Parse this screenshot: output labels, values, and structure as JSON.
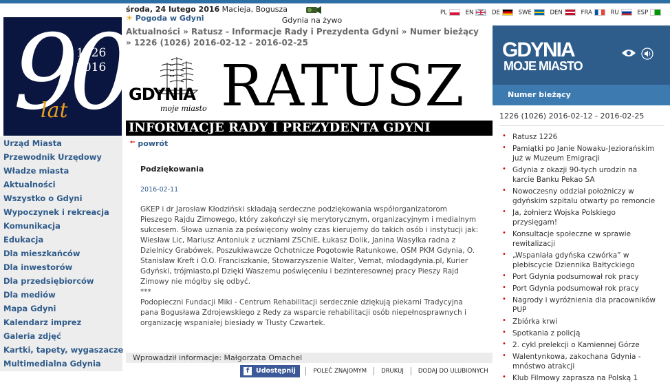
{
  "header": {
    "date": "środa, 24 lutego 2016",
    "names": "Macieja, Bogusza",
    "weather": "Pogoda w Gdyni",
    "live": "Gdynia na żywo",
    "languages": [
      {
        "code": "PL",
        "flag": "pl-flag"
      },
      {
        "code": "EN",
        "flag": "uk-flag"
      },
      {
        "code": "DE",
        "flag": "de-flag"
      },
      {
        "code": "SWE",
        "flag": "se-flag"
      },
      {
        "code": "DEN",
        "flag": "dk-flag"
      },
      {
        "code": "FRA",
        "flag": "fr-flag"
      },
      {
        "code": "RU",
        "flag": "ru-flag"
      },
      {
        "code": "ESP",
        "flag": "eo-flag"
      }
    ]
  },
  "logo": {
    "number": "90",
    "years": [
      "1926",
      "2016"
    ],
    "lat": "lat"
  },
  "nav": [
    "Urząd Miasta",
    "Przewodnik Urzędowy",
    "Władze miasta",
    "Aktualności",
    "Wszystko o Gdyni",
    "Wypoczynek i rekreacja",
    "Komunikacja",
    "Edukacja",
    "Dla mieszkańców",
    "Dla inwestorów",
    "Dla przedsiębiorców",
    "Dla mediów",
    "Mapa Gdyni",
    "Kalendarz imprez",
    "Galeria zdjęć",
    "Kartki, tapety, wygaszacze",
    "Multimedialna Gdynia"
  ],
  "breadcrumb": "Aktualności » Ratusz - Informacje Rady i Prezydenta Gdyni » Numer bieżący » 1226 (1026) 2016-02-12 - 2016-02-25",
  "banner": {
    "gdynia": "GDYNIA",
    "moje": "moje miasto",
    "ratusz": "RATUSZ",
    "strip": "INFORMACJE RADY I PREZYDENTA GDYNI"
  },
  "back": "powrót",
  "article": {
    "title": "Podziękowania",
    "date": "2016-02-11",
    "p1": "GKEP i dr Jarosław Kłodziński składają serdeczne podziękowania współorganizatorom Pieszego Rajdu Zimowego, który zakończył się merytorycznym, organizacyjnym i medialnym sukcesem. Słowa uznania za poświęcony wolny czas kierujemy do takich osób i instytucji jak: Wiesław Lic, Mariusz Antoniuk z uczniami ZSChiE, Łukasz Dolik, Janina Wasylka radna z Dzielnicy Grabówek, Poszukiwawcze Ochotnicze Pogotowie Ratunkowe, OSM PKM Gdynia, O. Stanisław Kreft i O.O. Franciszkanie, Stowarzyszenie Walter, Vemat, mlodagdynia.pl, Kurier Gdyński, trójmiasto.pl Dzięki Waszemu poświęceniu i bezinteresownej pracy Pieszy Rajd Zimowy nie mógłby się odbyć.",
    "sep": "***",
    "p2": "Podopieczni Fundacji Miki - Centrum Rehabilitacji serdecznie dziękują piekarni Tradycyjna pana Bogusława Zdrojewskiego z Redy za wsparcie rehabilitacji osób niepełnosprawnych i organizację wspaniałej biesiady w Tłusty Czwartek."
  },
  "footer": {
    "info": "Wprowadził informacje: Małgorzata Omachel",
    "share": "Udostępnij",
    "actions": [
      "POLEĆ ZNAJOMYM",
      "DRUKUJ",
      "DODAJ DO ULUBIONYCH"
    ]
  },
  "right": {
    "brand1": "GDYNIA",
    "brand2": "MOJE MIASTO",
    "section": "Numer bieżący",
    "issue": "1226 (1026) 2016-02-12 - 2016-02-25",
    "items": [
      "Ratusz 1226",
      "Pamiątki po Janie Nowaku-Jeziorańskim już w Muzeum Emigracji",
      "Gdynia z okazji 90-tych urodzin na karcie Banku Pekao SA",
      "Nowoczesny oddział położniczy w gdyńskim szpitalu otwarty po remoncie",
      "Ja, żołnierz Wojska Polskiego przysięgam!",
      "Konsultacje społeczne w sprawie rewitalizacji",
      "„Wspaniała gdyńska czwórka” w plebiscycie Dziennika Bałtyckiego",
      "Port Gdynia podsumował rok pracy",
      "Port Gdynia podsumował rok pracy",
      "Nagrody i wyróżnienia dla pracowników PUP",
      "Zbiórka krwi",
      "Spotkania z policją",
      "2. cykl prelekcji o Kamiennej Górze",
      "Walentynkowa, zakochana Gdynia - mnóstwo atrakcji",
      "Klub Filmowy zaprasza na Polską 1"
    ]
  }
}
